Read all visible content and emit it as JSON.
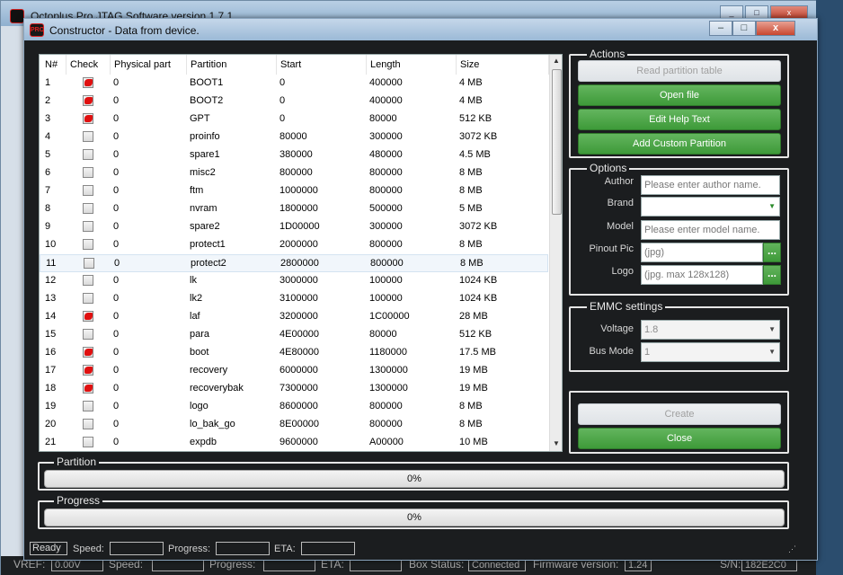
{
  "background_window": {
    "title": "Octoplus Pro JTAG Software version 1.7.1",
    "status": {
      "vref_label": "VREF:",
      "vref_value": "0.00V",
      "speed_label": "Speed:",
      "progress_label": "Progress:",
      "eta_label": "ETA:",
      "box_status_label": "Box Status:",
      "box_status_value": "Connected",
      "firmware_label": "Firmware version:",
      "firmware_value": "1.24",
      "sn_label": "S/N:",
      "sn_value": "182E2C0"
    }
  },
  "dialog": {
    "title": "Constructor - Data from device.",
    "logo_text": "PRO"
  },
  "table": {
    "headers": [
      "N#",
      "Check",
      "Physical part",
      "Partition",
      "Start",
      "Length",
      "Size"
    ],
    "rows": [
      {
        "n": "1",
        "checked": true,
        "phys": "0",
        "partition": "BOOT1",
        "start": "0",
        "length": "400000",
        "size": "4 MB"
      },
      {
        "n": "2",
        "checked": true,
        "phys": "0",
        "partition": "BOOT2",
        "start": "0",
        "length": "400000",
        "size": "4 MB"
      },
      {
        "n": "3",
        "checked": true,
        "phys": "0",
        "partition": "GPT",
        "start": "0",
        "length": "80000",
        "size": "512 KB"
      },
      {
        "n": "4",
        "checked": false,
        "phys": "0",
        "partition": "proinfo",
        "start": "80000",
        "length": "300000",
        "size": "3072 KB"
      },
      {
        "n": "5",
        "checked": false,
        "phys": "0",
        "partition": "spare1",
        "start": "380000",
        "length": "480000",
        "size": "4.5 MB"
      },
      {
        "n": "6",
        "checked": false,
        "phys": "0",
        "partition": "misc2",
        "start": "800000",
        "length": "800000",
        "size": "8 MB"
      },
      {
        "n": "7",
        "checked": false,
        "phys": "0",
        "partition": "ftm",
        "start": "1000000",
        "length": "800000",
        "size": "8 MB"
      },
      {
        "n": "8",
        "checked": false,
        "phys": "0",
        "partition": "nvram",
        "start": "1800000",
        "length": "500000",
        "size": "5 MB"
      },
      {
        "n": "9",
        "checked": false,
        "phys": "0",
        "partition": "spare2",
        "start": "1D00000",
        "length": "300000",
        "size": "3072 KB"
      },
      {
        "n": "10",
        "checked": false,
        "phys": "0",
        "partition": "protect1",
        "start": "2000000",
        "length": "800000",
        "size": "8 MB"
      },
      {
        "n": "11",
        "checked": false,
        "phys": "0",
        "partition": "protect2",
        "start": "2800000",
        "length": "800000",
        "size": "8 MB"
      },
      {
        "n": "12",
        "checked": false,
        "phys": "0",
        "partition": "lk",
        "start": "3000000",
        "length": "100000",
        "size": "1024 KB"
      },
      {
        "n": "13",
        "checked": false,
        "phys": "0",
        "partition": "lk2",
        "start": "3100000",
        "length": "100000",
        "size": "1024 KB"
      },
      {
        "n": "14",
        "checked": true,
        "phys": "0",
        "partition": "laf",
        "start": "3200000",
        "length": "1C00000",
        "size": "28 MB"
      },
      {
        "n": "15",
        "checked": false,
        "phys": "0",
        "partition": "para",
        "start": "4E00000",
        "length": "80000",
        "size": "512 KB"
      },
      {
        "n": "16",
        "checked": true,
        "phys": "0",
        "partition": "boot",
        "start": "4E80000",
        "length": "1180000",
        "size": "17.5 MB"
      },
      {
        "n": "17",
        "checked": true,
        "phys": "0",
        "partition": "recovery",
        "start": "6000000",
        "length": "1300000",
        "size": "19 MB"
      },
      {
        "n": "18",
        "checked": true,
        "phys": "0",
        "partition": "recoverybak",
        "start": "7300000",
        "length": "1300000",
        "size": "19 MB"
      },
      {
        "n": "19",
        "checked": false,
        "phys": "0",
        "partition": "logo",
        "start": "8600000",
        "length": "800000",
        "size": "8 MB"
      },
      {
        "n": "20",
        "checked": false,
        "phys": "0",
        "partition": "lo_bak_go",
        "start": "8E00000",
        "length": "800000",
        "size": "8 MB"
      },
      {
        "n": "21",
        "checked": false,
        "phys": "0",
        "partition": "expdb",
        "start": "9600000",
        "length": "A00000",
        "size": "10 MB"
      }
    ]
  },
  "actions": {
    "title": "Actions",
    "read_partition_table": "Read partition table",
    "open_file": "Open file",
    "edit_help_text": "Edit Help Text",
    "add_custom_partition": "Add Custom Partition"
  },
  "options": {
    "title": "Options",
    "author_label": "Author",
    "author_placeholder": "Please enter author name.",
    "brand_label": "Brand",
    "brand_value": "",
    "model_label": "Model",
    "model_placeholder": "Please enter model name.",
    "pinout_label": "Pinout Pic",
    "pinout_placeholder": "(jpg)",
    "logo_label": "Logo",
    "logo_placeholder": "(jpg. max 128x128)",
    "browse": "..."
  },
  "emmc": {
    "title": "EMMC settings",
    "voltage_label": "Voltage",
    "voltage_value": "1.8",
    "bus_mode_label": "Bus Mode",
    "bus_mode_value": "1"
  },
  "buttons": {
    "create": "Create",
    "close": "Close"
  },
  "partition_progress": {
    "title": "Partition",
    "value": 0,
    "text": "0%"
  },
  "progress": {
    "title": "Progress",
    "value": 0,
    "text": "0%"
  },
  "statusbar": {
    "ready": "Ready",
    "speed_label": "Speed:",
    "progress_label": "Progress:",
    "eta_label": "ETA:"
  }
}
